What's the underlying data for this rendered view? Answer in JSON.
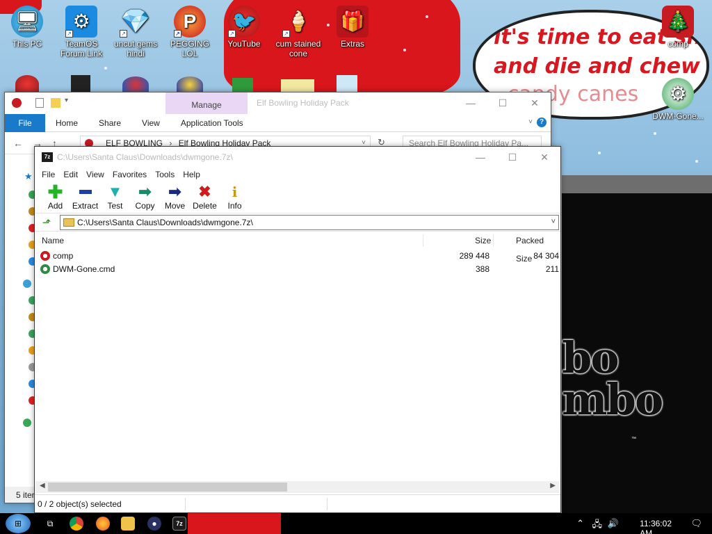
{
  "desktop": {
    "icons": [
      {
        "label": "This PC",
        "icon": "computer-icon"
      },
      {
        "label": "TeamOS Forum Link",
        "icon": "gear-icon"
      },
      {
        "label": "uncut gems hindi",
        "icon": "diamond-icon"
      },
      {
        "label": "PEGGING LOL",
        "icon": "p-letter-icon"
      },
      {
        "label": "YouTube",
        "icon": "angry-bird-icon"
      },
      {
        "label": "cum stained cone",
        "icon": "cone-icon"
      },
      {
        "label": "Extras",
        "icon": "gift-icon"
      },
      {
        "label": "comp",
        "icon": "ornament-icon"
      },
      {
        "label": "DWM-Gone...",
        "icon": "ornament-icon"
      }
    ],
    "bubble_lines": [
      "it's time to eat shit",
      "and die and chew",
      "candy canes"
    ],
    "logo_text": [
      "bo",
      "mbo"
    ]
  },
  "explorer": {
    "title": "Elf Bowling Holiday Pack",
    "manage_tab": "Manage",
    "ribbon_tabs": [
      "File",
      "Home",
      "Share",
      "View",
      "Application Tools"
    ],
    "breadcrumb": [
      "ELF BOWLING",
      "Elf Bowling Holiday Pack"
    ],
    "search_placeholder": "Search Elf Bowling Holiday Pa...",
    "status": "5 iter"
  },
  "sevenzip": {
    "title": "C:\\Users\\Santa Claus\\Downloads\\dwmgone.7z\\",
    "app_icon": "7z",
    "menu": [
      "File",
      "Edit",
      "View",
      "Favorites",
      "Tools",
      "Help"
    ],
    "toolbar": [
      {
        "label": "Add",
        "icon": "plus-icon",
        "color": "#22b422"
      },
      {
        "label": "Extract",
        "icon": "minus-icon",
        "color": "#1d3fa8"
      },
      {
        "label": "Test",
        "icon": "check-icon",
        "color": "#1fb0b0"
      },
      {
        "label": "Copy",
        "icon": "arrow-right-icon",
        "color": "#1a8a6a"
      },
      {
        "label": "Move",
        "icon": "arrow-right-icon",
        "color": "#1a2a80"
      },
      {
        "label": "Delete",
        "icon": "x-icon",
        "color": "#d11a1a"
      },
      {
        "label": "Info",
        "icon": "info-icon",
        "color": "#c89a10"
      }
    ],
    "path": "C:\\Users\\Santa Claus\\Downloads\\dwmgone.7z\\",
    "columns": [
      "Name",
      "Size",
      "Packed Size"
    ],
    "files": [
      {
        "name": "comp",
        "size": "289 448",
        "packed": "84 304",
        "icon": "ornament-icon"
      },
      {
        "name": "DWM-Gone.cmd",
        "size": "388",
        "packed": "211",
        "icon": "ornament-icon"
      }
    ],
    "status": "0 / 2 object(s) selected"
  },
  "taskbar": {
    "apps": [
      "start-icon",
      "task-view-icon",
      "chrome-icon",
      "firefox-icon",
      "file-explorer-icon",
      "bomb-icon",
      "7zip-icon"
    ],
    "clock": "11:36:02 AM"
  }
}
